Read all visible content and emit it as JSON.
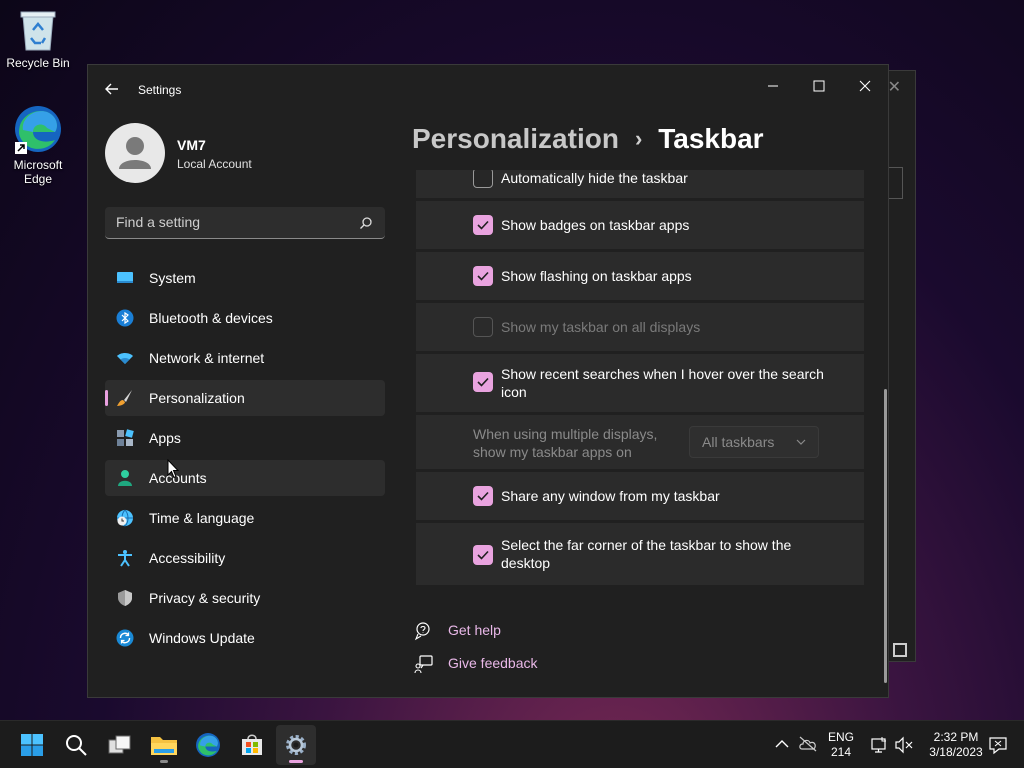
{
  "desktop": {
    "icons": [
      {
        "label": "Recycle Bin",
        "icon": "recycle-bin-icon"
      },
      {
        "label": "Microsoft Edge",
        "icon": "edge-icon"
      }
    ]
  },
  "window": {
    "title": "Settings",
    "controls": {
      "minimize": "minimize-icon",
      "maximize": "maximize-icon",
      "close": "close-icon"
    }
  },
  "profile": {
    "name": "VM7",
    "account_type": "Local Account"
  },
  "search": {
    "placeholder": "Find a setting",
    "value": ""
  },
  "nav": {
    "selected": "Personalization",
    "items": [
      {
        "label": "System",
        "icon": "system-icon"
      },
      {
        "label": "Bluetooth & devices",
        "icon": "bluetooth-icon"
      },
      {
        "label": "Network & internet",
        "icon": "wifi-icon"
      },
      {
        "label": "Personalization",
        "icon": "brush-icon"
      },
      {
        "label": "Apps",
        "icon": "apps-icon"
      },
      {
        "label": "Accounts",
        "icon": "account-icon"
      },
      {
        "label": "Time & language",
        "icon": "globe-clock-icon"
      },
      {
        "label": "Accessibility",
        "icon": "accessibility-icon"
      },
      {
        "label": "Privacy & security",
        "icon": "shield-icon"
      },
      {
        "label": "Windows Update",
        "icon": "update-icon"
      }
    ]
  },
  "breadcrumb": {
    "parent": "Personalization",
    "separator": "›",
    "current": "Taskbar"
  },
  "settings_rows": [
    {
      "label": "Automatically hide the taskbar",
      "checked": false,
      "disabled": false
    },
    {
      "label": "Show badges on taskbar apps",
      "checked": true,
      "disabled": false
    },
    {
      "label": "Show flashing on taskbar apps",
      "checked": true,
      "disabled": false
    },
    {
      "label": "Show my taskbar on all displays",
      "checked": false,
      "disabled": true
    },
    {
      "label": "Show recent searches when I hover over the search icon",
      "checked": true,
      "disabled": false
    },
    {
      "label": "When using multiple displays, show my taskbar apps on",
      "dropdown_value": "All taskbars",
      "disabled": true
    },
    {
      "label": "Share any window from my taskbar",
      "checked": true,
      "disabled": false
    },
    {
      "label": "Select the far corner of the taskbar to show the desktop",
      "checked": true,
      "disabled": false
    }
  ],
  "links": [
    {
      "label": "Get help",
      "icon": "help-icon"
    },
    {
      "label": "Give feedback",
      "icon": "feedback-icon"
    }
  ],
  "taskbar": {
    "apps": [
      "start-icon",
      "search-icon",
      "task-view-icon",
      "file-explorer-icon",
      "edge-icon",
      "store-icon",
      "settings-icon"
    ],
    "tray": {
      "language": "ENG",
      "layout": "214",
      "time": "2:32 PM",
      "date": "3/18/2023"
    }
  },
  "colors": {
    "accent": "#e9a3df",
    "window_bg": "#202020",
    "card_bg": "#2b2b2b"
  }
}
